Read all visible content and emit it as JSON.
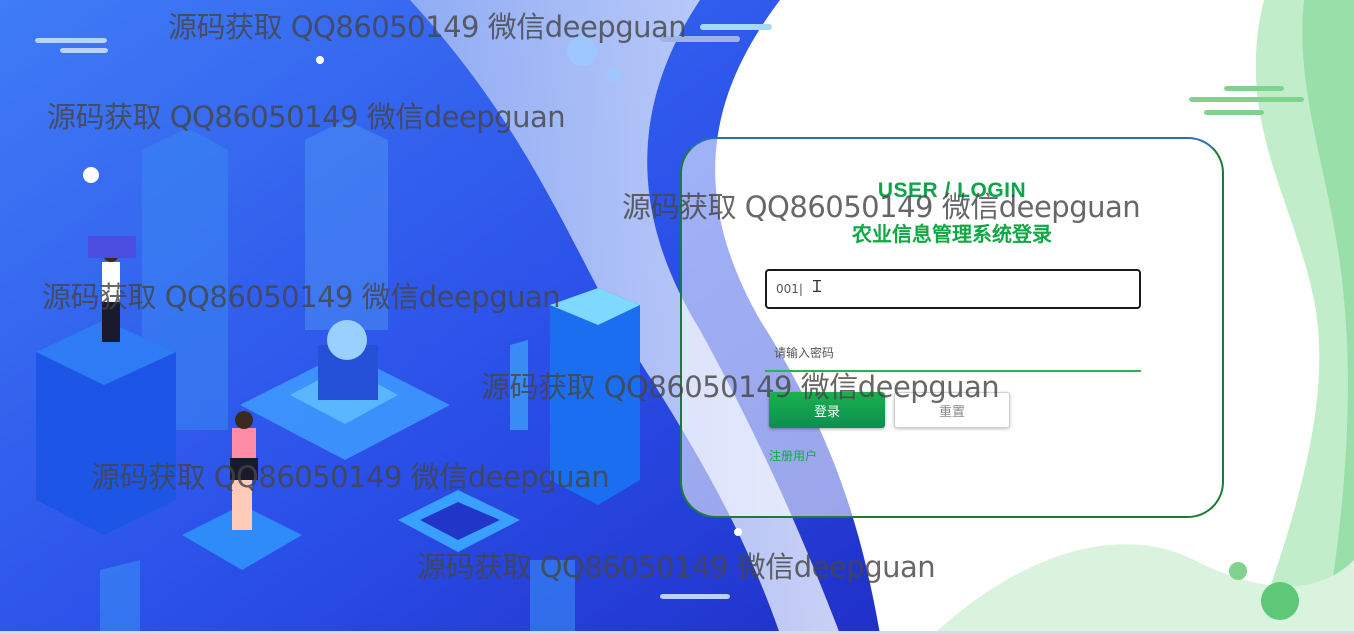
{
  "login": {
    "title_en": "USER / LOGIN",
    "title_cn": "农业信息管理系统登录",
    "username_value": "001|",
    "password_placeholder": "请输入密码",
    "login_label": "登录",
    "reset_label": "重置",
    "register_label": "注册用户"
  },
  "watermarks": [
    "源码获取 QQ86050149 微信deepguan",
    "源码获取 QQ86050149 微信deepguan",
    "源码获取 QQ86050149 微信deepguan",
    "源码获取 QQ86050149 微信deepguan",
    "源码获取 QQ86050149 微信deepguan",
    "源码获取 QQ86050149 微信deepguan",
    "源码获取 QQ86050149 微信deepguan"
  ],
  "colors": {
    "accent_green": "#10a843",
    "background_blue": "#2a5bf0",
    "card_border": "#1e7a3a"
  },
  "icons": {
    "cursor": "text-cursor-icon"
  }
}
